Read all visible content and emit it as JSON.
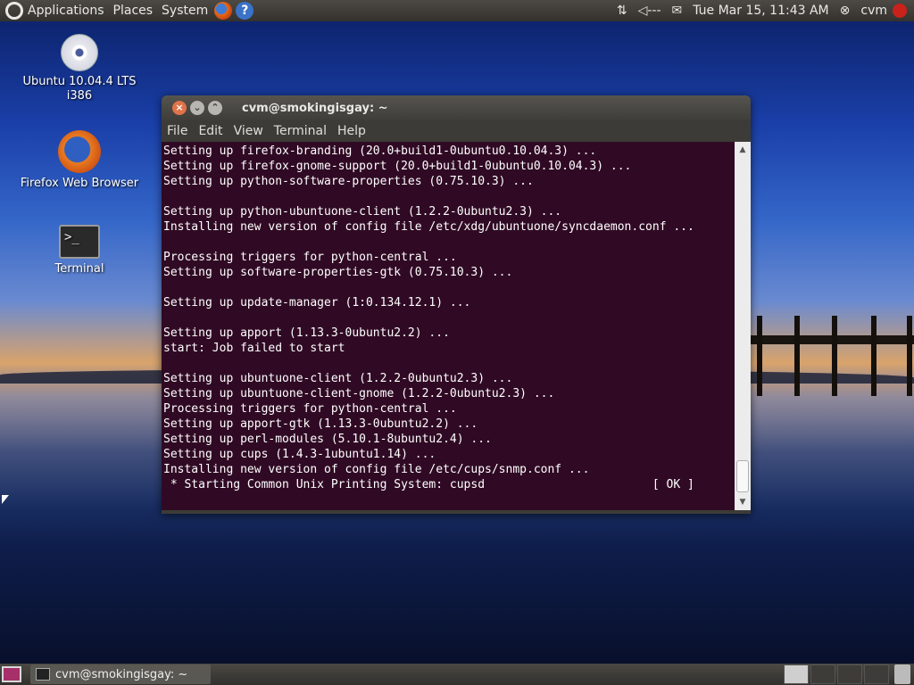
{
  "top_panel": {
    "applications_label": "Applications",
    "places_label": "Places",
    "system_label": "System",
    "help_glyph": "?",
    "volume_label": "◁---",
    "datetime": "Tue Mar 15, 11:43 AM",
    "user_label": "cvm"
  },
  "desktop": {
    "icons": [
      {
        "label": "Ubuntu 10.04.4 LTS i386",
        "icon": "cd-icon"
      },
      {
        "label": "Firefox Web Browser",
        "icon": "firefox-icon"
      },
      {
        "label": "Terminal",
        "icon": "terminal-icon"
      }
    ]
  },
  "window": {
    "title": "cvm@smokingisgay: ~",
    "menus": [
      "File",
      "Edit",
      "View",
      "Terminal",
      "Help"
    ],
    "terminal_output": "Setting up firefox-branding (20.0+build1-0ubuntu0.10.04.3) ...\nSetting up firefox-gnome-support (20.0+build1-0ubuntu0.10.04.3) ...\nSetting up python-software-properties (0.75.10.3) ...\n\nSetting up python-ubuntuone-client (1.2.2-0ubuntu2.3) ...\nInstalling new version of config file /etc/xdg/ubuntuone/syncdaemon.conf ...\n\nProcessing triggers for python-central ...\nSetting up software-properties-gtk (0.75.10.3) ...\n\nSetting up update-manager (1:0.134.12.1) ...\n\nSetting up apport (1.13.3-0ubuntu2.2) ...\nstart: Job failed to start\n\nSetting up ubuntuone-client (1.2.2-0ubuntu2.3) ...\nSetting up ubuntuone-client-gnome (1.2.2-0ubuntu2.3) ...\nProcessing triggers for python-central ...\nSetting up apport-gtk (1.13.3-0ubuntu2.2) ...\nSetting up perl-modules (5.10.1-8ubuntu2.4) ...\nSetting up cups (1.4.3-1ubuntu1.14) ...\nInstalling new version of config file /etc/cups/snmp.conf ...\n * Starting Common Unix Printing System: cupsd                        [ OK ]"
  },
  "bottom_panel": {
    "task_label": "cvm@smokingisgay: ~"
  },
  "colors": {
    "terminal_bg": "#300a24",
    "panel_bg": "#3c3b37",
    "close_button": "#e0734a"
  }
}
